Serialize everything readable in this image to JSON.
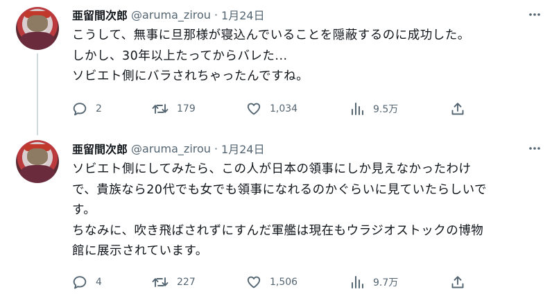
{
  "tweets": [
    {
      "display_name": "亜留間次郎",
      "handle": "@aruma_zirou",
      "separator": "·",
      "date": "1月24日",
      "text": "こうして、無事に旦那様が寝込んでいることを隠蔽するのに成功した。\nしかし、30年以上たってからバレた...\nソビエト側にバラされちゃったんですね。",
      "replies": "2",
      "retweets": "179",
      "likes": "1,034",
      "views": "9.5万"
    },
    {
      "display_name": "亜留間次郎",
      "handle": "@aruma_zirou",
      "separator": "·",
      "date": "1月24日",
      "text": "ソビエト側にしてみたら、この人が日本の領事にしか見えなかったわけ\nで、貴族なら20代でも女でも領事になれるのかぐらいに見ていたらしいで\nす。\nちなみに、吹き飛ばされずにすんだ軍艦は現在もウラジオストックの博物\n館に展示されています。",
      "replies": "4",
      "retweets": "227",
      "likes": "1,506",
      "views": "9.7万"
    }
  ],
  "icons": {
    "more": "more-horizontal-icon",
    "reply": "reply-icon",
    "retweet": "retweet-icon",
    "like": "heart-icon",
    "views": "views-chart-icon",
    "share": "share-icon"
  },
  "colors": {
    "icon": "#536471",
    "text": "#0f1419",
    "muted": "#536471",
    "thread": "#cfd9de"
  }
}
